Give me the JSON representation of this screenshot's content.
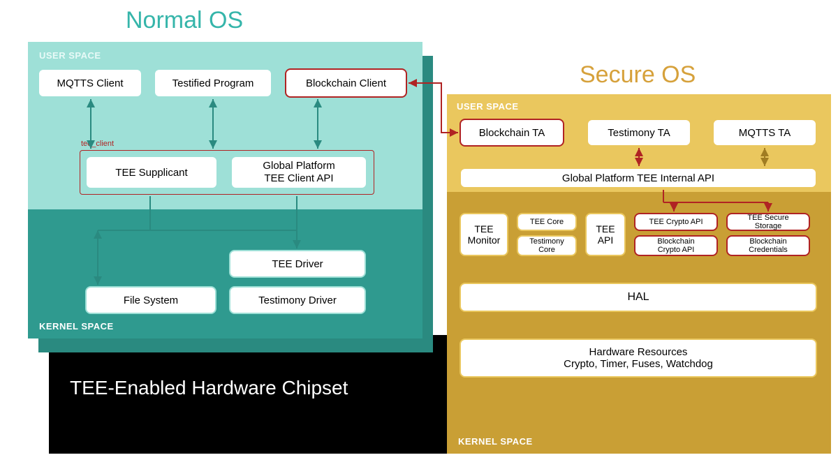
{
  "titles": {
    "normal": "Normal OS",
    "secure": "Secure OS",
    "chipset": "TEE-Enabled Hardware Chipset"
  },
  "labels": {
    "user_space": "USER SPACE",
    "kernel_space": "KERNEL SPACE",
    "tee_client": "tee_client"
  },
  "normal": {
    "user_boxes": {
      "mqtts": "MQTTS Client",
      "testified": "Testified Program",
      "blockchain": "Blockchain Client",
      "supplicant": "TEE Supplicant",
      "gp_client": "Global Platform\nTEE Client API"
    },
    "kernel_boxes": {
      "tee_driver": "TEE Driver",
      "file_system": "File System",
      "testimony_driver": "Testimony Driver"
    }
  },
  "secure": {
    "user_boxes": {
      "blockchain_ta": "Blockchain TA",
      "testimony_ta": "Testimony TA",
      "mqtts_ta": "MQTTS TA"
    },
    "gp_internal": "Global Platform TEE Internal API",
    "kernel_boxes": {
      "tee_monitor": "TEE\nMonitor",
      "tee_core": "TEE Core",
      "testimony_core": "Testimony\nCore",
      "tee_api": "TEE\nAPI",
      "crypto_api": "TEE Crypto API",
      "blockchain_crypto": "Blockchain\nCrypto API",
      "secure_storage": "TEE Secure\nStorage",
      "blockchain_creds": "Blockchain\nCredentials",
      "hal": "HAL",
      "hw_resources_title": "Hardware Resources",
      "hw_resources_sub": "Crypto, Timer, Fuses, Watchdog"
    }
  },
  "colors": {
    "normal_title": "#35b5aa",
    "secure_title": "#d6a13b",
    "red": "#b02323",
    "teal_user": "#9ee0d7",
    "teal_kernel": "#2f9a8f",
    "gold_user": "#eac75e",
    "gold_kernel": "#c99f35"
  }
}
